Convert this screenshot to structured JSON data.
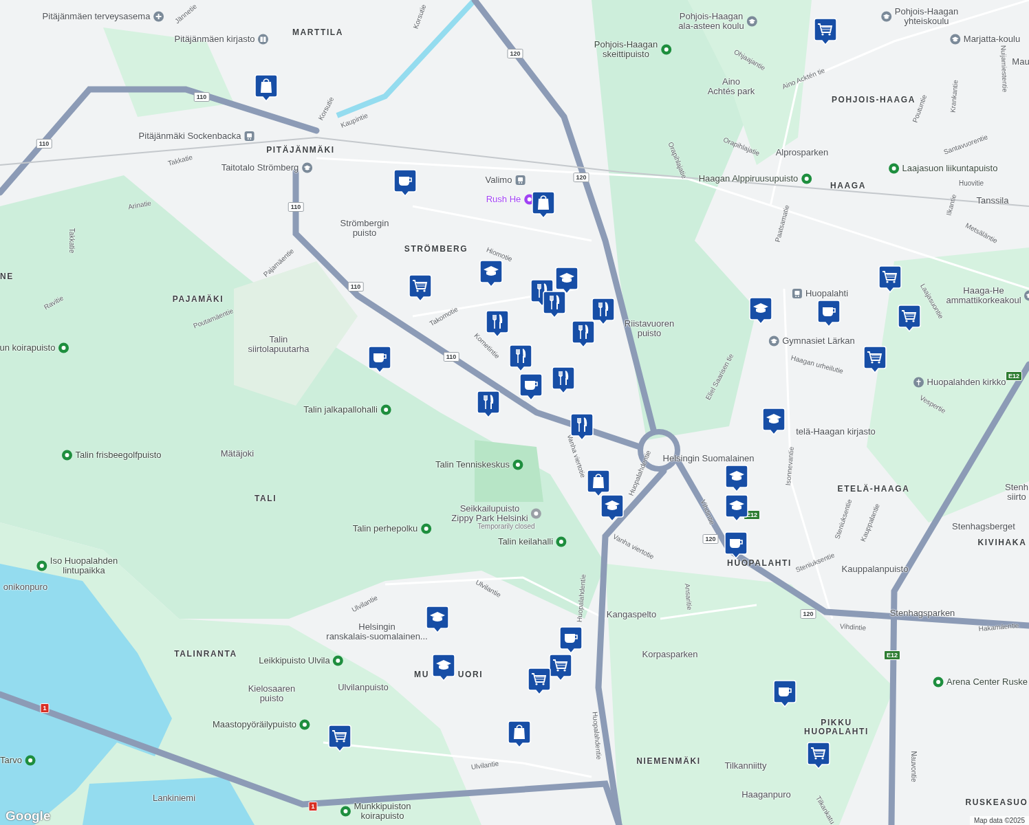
{
  "map": {
    "districts": [
      {
        "text": "MARTTILA"
      },
      {
        "text": "PITÄJÄNMÄKI"
      },
      {
        "text": "STRÖMBERG"
      },
      {
        "text": "PAJAMÄKI"
      },
      {
        "text": "TALI"
      },
      {
        "text": "TALINRANTA"
      },
      {
        "text": "MU"
      },
      {
        "text": "UORI"
      },
      {
        "text": "NIEMENMÄKI"
      },
      {
        "text": "POHJOIS-HAAGA"
      },
      {
        "text": "HAAGA"
      },
      {
        "text": "ETELÄ-HAAGA"
      },
      {
        "text": "KIVIHAKA"
      },
      {
        "text": "HUOPALAHTI"
      },
      {
        "text": "PIKKU\nHUOPALAHTI"
      },
      {
        "text": "RUSKEASUO"
      },
      {
        "text": "NE"
      }
    ],
    "places": [
      {
        "text": "Pitäjänmäen terveysasema",
        "kind": "health"
      },
      {
        "text": "Pitäjänmäen kirjasto",
        "kind": "library"
      },
      {
        "text": "Pitäjänmäki Sockenbacka",
        "kind": "transit"
      },
      {
        "text": "Taitotalo Strömberg",
        "kind": "school"
      },
      {
        "text": "Valimo",
        "kind": "transit"
      },
      {
        "text": "Rush He",
        "kind": "venue"
      },
      {
        "text": "Strömbergin\npuisto",
        "kind": "area"
      },
      {
        "text": "un koirapuisto",
        "kind": "park"
      },
      {
        "text": "Talin\nsiirtolapuutarha",
        "kind": "area"
      },
      {
        "text": "Talin jalkapallohalli",
        "kind": "park"
      },
      {
        "text": "Talin frisbeegolfpuisto",
        "kind": "park"
      },
      {
        "text": "Mätäjoki",
        "kind": "area"
      },
      {
        "text": "Talin Tenniskeskus",
        "kind": "park"
      },
      {
        "text": "Seikkailupuisto\nZippy Park Helsinki",
        "kind": "attraction"
      },
      {
        "text": "Talin perhepolku",
        "kind": "park"
      },
      {
        "text": "Temporarily closed",
        "kind": "note"
      },
      {
        "text": "Talin keilahalli",
        "kind": "park"
      },
      {
        "text": "Iso Huopalahden\nlintupaikka",
        "kind": "park"
      },
      {
        "text": "onikonpuro",
        "kind": "area"
      },
      {
        "text": "Helsingin\nranskalais-suomalainen...",
        "kind": "area"
      },
      {
        "text": "Leikkipuisto Ulvila",
        "kind": "park"
      },
      {
        "text": "Ulvilanpuisto",
        "kind": "area"
      },
      {
        "text": "Kielosaaren\npuisto",
        "kind": "area"
      },
      {
        "text": "Maastopyöräilypuisto",
        "kind": "park"
      },
      {
        "text": "Tarvo",
        "kind": "park"
      },
      {
        "text": "Lankiniemi",
        "kind": "area"
      },
      {
        "text": "Munkkipuiston\nkoirapuisto",
        "kind": "park"
      },
      {
        "text": "Kangaspelto",
        "kind": "area"
      },
      {
        "text": "Korpasparken",
        "kind": "area"
      },
      {
        "text": "Tilkanniitty",
        "kind": "area"
      },
      {
        "text": "Haaganpuro",
        "kind": "area"
      },
      {
        "text": "Pohjois-Haagan\nskeittipuisto",
        "kind": "park"
      },
      {
        "text": "Pohjois-Haagan\nala-asteen koulu",
        "kind": "school"
      },
      {
        "text": "Aino\nAchtés park",
        "kind": "area"
      },
      {
        "text": "Pohjois-Haagan\nyhteiskoulu",
        "kind": "school"
      },
      {
        "text": "Marjatta-koulu",
        "kind": "school"
      },
      {
        "text": "Mau",
        "kind": "area"
      },
      {
        "text": "Alprosparken",
        "kind": "area"
      },
      {
        "text": "Laajasuon liikuntapuisto",
        "kind": "park"
      },
      {
        "text": "Haagan Alppiruusupuisto",
        "kind": "park"
      },
      {
        "text": "Tanssila",
        "kind": "area"
      },
      {
        "text": "Riistavuoren\npuisto",
        "kind": "area"
      },
      {
        "text": "Huopalahti",
        "kind": "transit"
      },
      {
        "text": "Gymnasiet Lärkan",
        "kind": "school"
      },
      {
        "text": "Haaga-He\nammattikorkeakoul",
        "kind": "school"
      },
      {
        "text": "Huopalahden kirkko",
        "kind": "church"
      },
      {
        "text": "telä-Haagan kirjasto",
        "kind": "area"
      },
      {
        "text": "Helsingin Suomalainen",
        "kind": "area"
      },
      {
        "text": "Stenhagsberget",
        "kind": "area"
      },
      {
        "text": "Stenh\nsiirto",
        "kind": "area"
      },
      {
        "text": "Kauppalanpuisto",
        "kind": "area"
      },
      {
        "text": "Stenhagsparken",
        "kind": "area"
      },
      {
        "text": "Arena Center Ruske",
        "kind": "park"
      }
    ],
    "roads": [
      {
        "text": "Kaupintie"
      },
      {
        "text": "Korsutie"
      },
      {
        "text": "Korsutie"
      },
      {
        "text": "Jännetie"
      },
      {
        "text": "Takkatie"
      },
      {
        "text": "Arinatie"
      },
      {
        "text": "Takkatie"
      },
      {
        "text": "Pajamäentie"
      },
      {
        "text": "Ravitie"
      },
      {
        "text": "Poutamäentie"
      },
      {
        "text": "Hiomotie"
      },
      {
        "text": "Takomotie"
      },
      {
        "text": "Kometintie"
      },
      {
        "text": "Vanha viertotie"
      },
      {
        "text": "Vanha viertotie"
      },
      {
        "text": "Huopalahdentie"
      },
      {
        "text": "Huopalahdentie"
      },
      {
        "text": "Huopalahdentie"
      },
      {
        "text": "Ulvilantie"
      },
      {
        "text": "Ulvilantie"
      },
      {
        "text": "Ulvilantie"
      },
      {
        "text": "Eliel Saarisen tie"
      },
      {
        "text": "Haagan urheilutie"
      },
      {
        "text": "Vespertie"
      },
      {
        "text": "Vihdintie"
      },
      {
        "text": "Vihdintie"
      },
      {
        "text": "Hakamäentie"
      },
      {
        "text": "Isonnevantie"
      },
      {
        "text": "Steniuksentie"
      },
      {
        "text": "Steniuksentie"
      },
      {
        "text": "Ansaritie"
      },
      {
        "text": "Kauppalantie"
      },
      {
        "text": "Ohjaajantie"
      },
      {
        "text": "Aino Acktén tie"
      },
      {
        "text": "Orapihlajatie"
      },
      {
        "text": "Orapihlajatie"
      },
      {
        "text": "Paatsamatie"
      },
      {
        "text": "Santavuorentie"
      },
      {
        "text": "Poutuntie"
      },
      {
        "text": "Krankantie"
      },
      {
        "text": "Huovitie"
      },
      {
        "text": "Ilkantie"
      },
      {
        "text": "Metsäläntie"
      },
      {
        "text": "Laajasuontie"
      },
      {
        "text": "Nuijamiestentie"
      },
      {
        "text": "Tilkankatu"
      },
      {
        "text": "Nauvontie"
      }
    ],
    "route_shields": [
      {
        "text": "110",
        "kind": "national"
      },
      {
        "text": "110",
        "kind": "national"
      },
      {
        "text": "110",
        "kind": "national"
      },
      {
        "text": "110",
        "kind": "national"
      },
      {
        "text": "110",
        "kind": "national"
      },
      {
        "text": "120",
        "kind": "national"
      },
      {
        "text": "120",
        "kind": "national"
      },
      {
        "text": "120",
        "kind": "national"
      },
      {
        "text": "120",
        "kind": "national"
      },
      {
        "text": "E12",
        "kind": "european"
      },
      {
        "text": "E12",
        "kind": "european"
      },
      {
        "text": "E12",
        "kind": "european"
      },
      {
        "text": "1",
        "kind": "motorway"
      },
      {
        "text": "1",
        "kind": "motorway"
      }
    ],
    "markers": [
      {
        "kind": "shop"
      },
      {
        "kind": "shop"
      },
      {
        "kind": "shop"
      },
      {
        "kind": "shop"
      },
      {
        "kind": "cafe"
      },
      {
        "kind": "cafe"
      },
      {
        "kind": "cafe"
      },
      {
        "kind": "cafe"
      },
      {
        "kind": "cafe"
      },
      {
        "kind": "cafe"
      },
      {
        "kind": "cafe"
      },
      {
        "kind": "grocery"
      },
      {
        "kind": "grocery"
      },
      {
        "kind": "grocery"
      },
      {
        "kind": "grocery"
      },
      {
        "kind": "grocery"
      },
      {
        "kind": "grocery"
      },
      {
        "kind": "grocery"
      },
      {
        "kind": "grocery"
      },
      {
        "kind": "grocery"
      },
      {
        "kind": "school"
      },
      {
        "kind": "school"
      },
      {
        "kind": "school"
      },
      {
        "kind": "school"
      },
      {
        "kind": "school"
      },
      {
        "kind": "school"
      },
      {
        "kind": "school"
      },
      {
        "kind": "school"
      },
      {
        "kind": "school"
      },
      {
        "kind": "restaurant"
      },
      {
        "kind": "restaurant"
      },
      {
        "kind": "restaurant"
      },
      {
        "kind": "restaurant"
      },
      {
        "kind": "restaurant"
      },
      {
        "kind": "restaurant"
      },
      {
        "kind": "restaurant"
      },
      {
        "kind": "restaurant"
      },
      {
        "kind": "restaurant"
      }
    ]
  },
  "attribution": {
    "logo": "Google",
    "text": "Map data ©2025"
  }
}
